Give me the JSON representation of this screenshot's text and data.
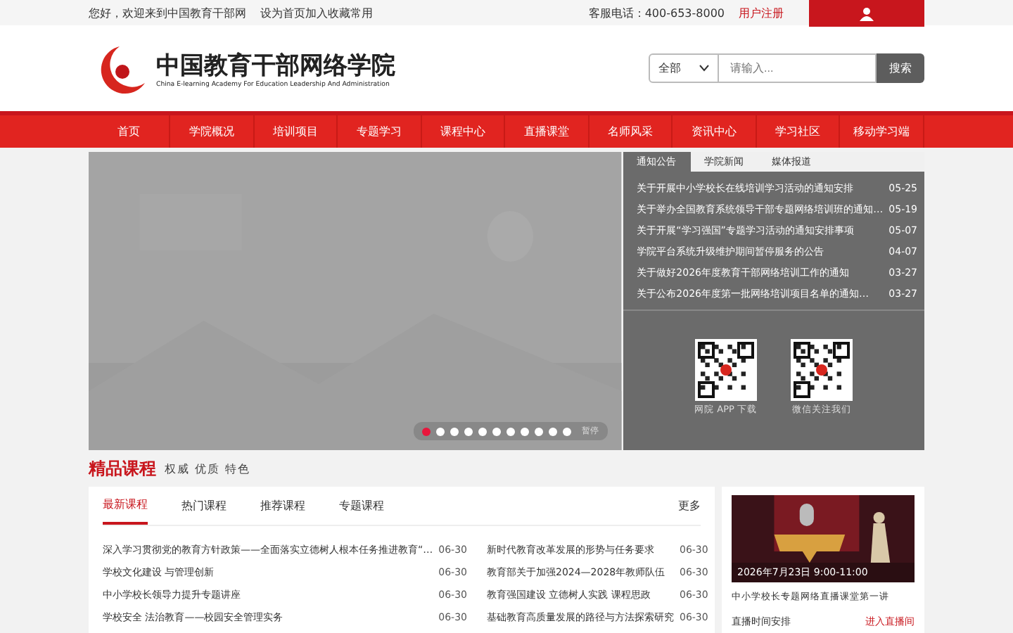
{
  "top_bar": {
    "links": [
      "您好，欢迎来到中国教育干部网",
      "设为首页加入收藏常用"
    ],
    "phone": "客服电话：400-653-8000",
    "register": "用户注册"
  },
  "header": {
    "logo_title": "中国教育干部网络学院",
    "logo_subtitle": "China E-learning Academy For Education Leadership And Administration",
    "search": {
      "scope": "全部",
      "placeholder": "请输入...",
      "button": "搜索"
    }
  },
  "nav": [
    {
      "label": "首页"
    },
    {
      "label": "学院概况"
    },
    {
      "label": "培训项目"
    },
    {
      "label": "专题学习"
    },
    {
      "label": "课程中心"
    },
    {
      "label": "直播课堂"
    },
    {
      "label": "名师风采"
    },
    {
      "label": "资讯中心"
    },
    {
      "label": "学习社区"
    },
    {
      "label": "移动学习端"
    }
  ],
  "slider": {
    "dots": [
      {
        "selected": true
      },
      {
        "selected": false
      },
      {
        "selected": false
      },
      {
        "selected": false
      },
      {
        "selected": false
      },
      {
        "selected": false
      },
      {
        "selected": false
      },
      {
        "selected": false
      },
      {
        "selected": false
      },
      {
        "selected": false
      },
      {
        "selected": false
      }
    ],
    "control": "暂停"
  },
  "news": {
    "tabs": [
      {
        "label": "通知公告",
        "selected": true
      },
      {
        "label": "学院新闻",
        "selected": false
      },
      {
        "label": "媒体报道",
        "selected": false
      }
    ],
    "items": [
      {
        "title": "关于开展中小学校长在线培训学习活动的通知安排",
        "date": "05-25"
      },
      {
        "title": "关于举办全国教育系统领导干部专题网络培训班的通知…",
        "date": "05-19"
      },
      {
        "title": "关于开展“学习强国”专题学习活动的通知安排事项",
        "date": "05-07"
      },
      {
        "title": "学院平台系统升级维护期间暂停服务的公告",
        "date": "04-07"
      },
      {
        "title": "关于做好2026年度教育干部网络培训工作的通知",
        "date": "03-27"
      },
      {
        "title": "关于公布2026年度第一批网络培训项目名单的通知…",
        "date": "03-27"
      }
    ],
    "qr_codes": [
      {
        "caption": "网院 APP 下载"
      },
      {
        "caption": "微信关注我们"
      }
    ]
  },
  "courses": {
    "title": "精品课程",
    "slogan": "权威 优质 特色",
    "tabs": [
      {
        "label": "最新课程",
        "selected": true
      },
      {
        "label": "热门课程",
        "selected": false
      },
      {
        "label": "推荐课程",
        "selected": false
      },
      {
        "label": "专题课程",
        "selected": false
      }
    ],
    "more": "更多",
    "items": [
      {
        "title": "深入学习贯彻党的教育方针政策——全面落实立德树人根本任务推进教育“…",
        "date": "06-30"
      },
      {
        "title": "新时代教育改革发展的形势与任务要求",
        "date": "06-30"
      },
      {
        "title": "学校文化建设 与管理创新",
        "date": "06-30"
      },
      {
        "title": "教育部关于加强2024—2028年教师队伍",
        "date": "06-30"
      },
      {
        "title": "中小学校长领导力提升专题讲座",
        "date": "06-30"
      },
      {
        "title": "教育强国建设 立德树人实践 课程思政",
        "date": "06-30"
      },
      {
        "title": "学校安全 法治教育——校园安全管理实务",
        "date": "06-30"
      },
      {
        "title": "基础教育高质量发展的路径与方法探索研究",
        "date": "06-30"
      }
    ]
  },
  "live": {
    "caption": "2026年7月23日 9:00-11:00",
    "title": "中小学校长专题网络直播课堂第一讲",
    "time": "直播时间安排",
    "link": "进入直播间"
  }
}
